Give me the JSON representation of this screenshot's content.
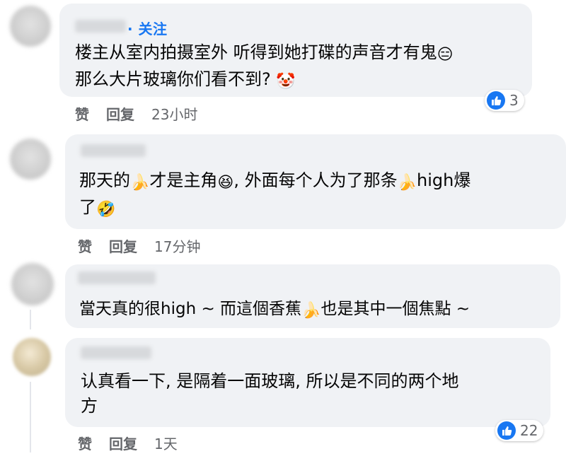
{
  "comments": [
    {
      "follow_label": "· 关注",
      "lines": [
        "楼主从室内拍摄室外 听得到她打碟的声音才有鬼",
        "那么大片玻璃你们看不到?"
      ],
      "emoji1": "😑",
      "emoji2": "🤡",
      "like_label": "赞",
      "reply_label": "回复",
      "time": "23小时",
      "reaction_count": "3",
      "reaction_icon": "thumbs-up-icon"
    },
    {
      "line1_a": "那天的",
      "line1_b": "才是主角",
      "line1_c": ", 外面每个人为了那条",
      "line1_d": "high爆",
      "line2": "了",
      "emoji_banana": "🍌",
      "emoji_grin": "😆",
      "emoji_laugh": "🤣",
      "like_label": "赞",
      "reply_label": "回复",
      "time": "17分钟"
    },
    {
      "line1_a": "當天真的很high ~ 而這個香蕉",
      "line1_b": "也是其中一個焦點 ~",
      "emoji_banana": "🍌"
    },
    {
      "lines": [
        "认真看一下, 是隔着一面玻璃, 所以是不同的两个地",
        "方"
      ],
      "like_label": "赞",
      "reply_label": "回复",
      "time": "1天",
      "reaction_count": "22",
      "reaction_icon": "thumbs-up-icon"
    }
  ],
  "colors": {
    "bubble": "#f0f2f5",
    "accent": "#1877f2",
    "meta": "#65676b"
  }
}
